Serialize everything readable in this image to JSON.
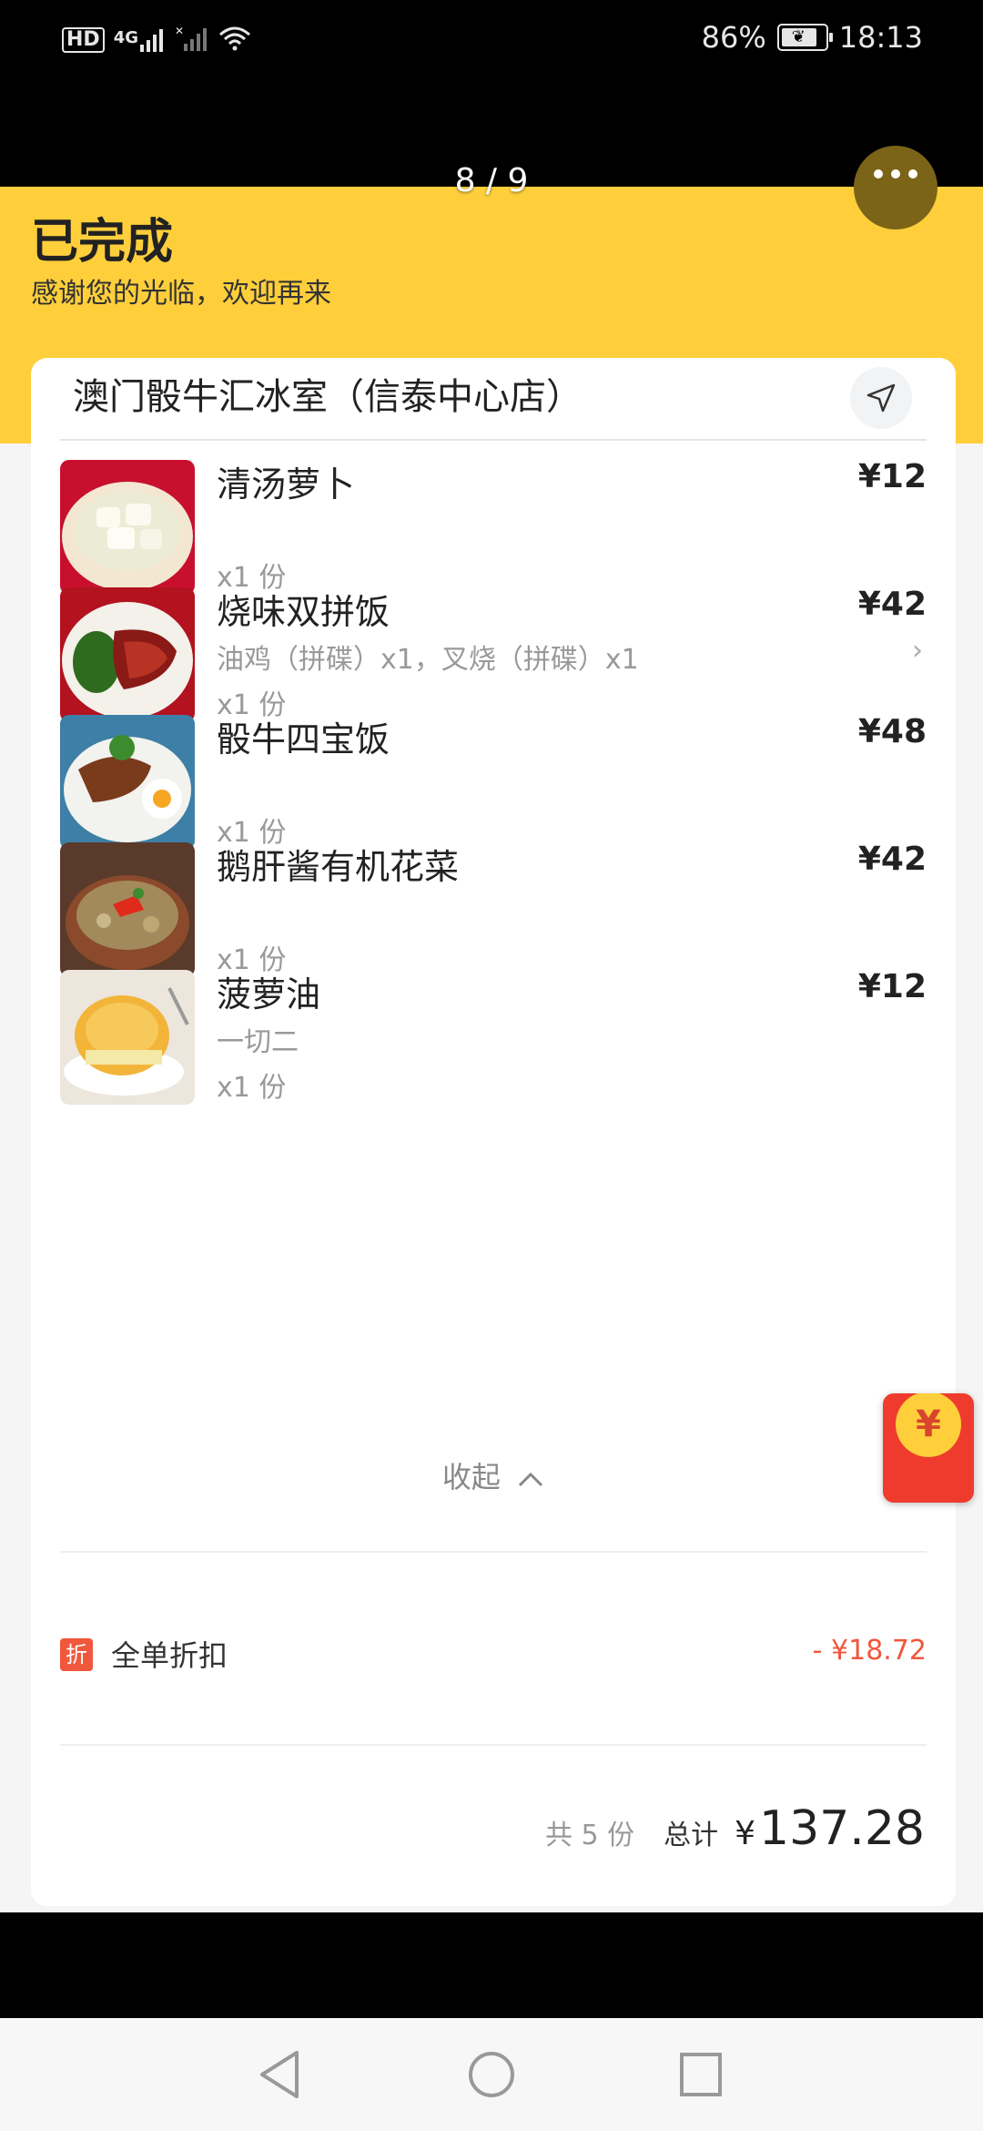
{
  "status_bar": {
    "left_icons": [
      "hd-icon",
      "signal-4g-icon",
      "signal-sim2-icon",
      "wifi-icon"
    ],
    "hd_text": "HD",
    "net_text": "4G",
    "battery_percent": "86%",
    "battery_level": 0.86,
    "time": "18:13"
  },
  "viewer": {
    "page_counter": "8 / 9"
  },
  "order": {
    "status_title": "已完成",
    "status_subtitle": "感谢您的光临，欢迎再来",
    "store_name": "澳门骰牛汇冰室（信泰中心店）",
    "items": [
      {
        "name": "清汤萝卜",
        "spec": "",
        "qty": "x1 份",
        "price": "¥12",
        "has_detail": false
      },
      {
        "name": "烧味双拼饭",
        "spec": "油鸡（拼碟）x1，叉烧（拼碟）x1",
        "qty": "x1 份",
        "price": "¥42",
        "has_detail": true
      },
      {
        "name": "骰牛四宝饭",
        "spec": "",
        "qty": "x1 份",
        "price": "¥48",
        "has_detail": false
      },
      {
        "name": "鹅肝酱有机花菜",
        "spec": "",
        "qty": "x1 份",
        "price": "¥42",
        "has_detail": false
      },
      {
        "name": "菠萝油",
        "spec": "一切二",
        "qty": "x1 份",
        "price": "¥12",
        "has_detail": false
      }
    ],
    "collapse_label": "收起",
    "discount": {
      "badge": "折",
      "label": "全单折扣",
      "amount": "- ¥18.72"
    },
    "summary": {
      "count": "共 5 份",
      "total_label": "总计",
      "currency": "¥",
      "total_value": "137.28"
    }
  },
  "red_packet": {
    "symbol": "¥"
  },
  "colors": {
    "banner": "#fecf3b",
    "discount": "#f0573c",
    "red_packet": "#ef3b2d"
  }
}
